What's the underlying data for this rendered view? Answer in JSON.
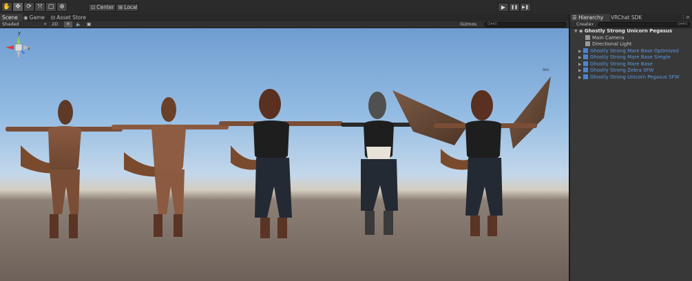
{
  "toolbar": {
    "tools": [
      {
        "name": "hand-tool-icon",
        "glyph": "✋"
      },
      {
        "name": "move-tool-icon",
        "glyph": "✥"
      },
      {
        "name": "rotate-tool-icon",
        "glyph": "⟳"
      },
      {
        "name": "scale-tool-icon",
        "glyph": "⤧"
      },
      {
        "name": "rect-tool-icon",
        "glyph": "▢"
      },
      {
        "name": "transform-tool-icon",
        "glyph": "⊕"
      }
    ],
    "pivot_label": "Center",
    "space_label": "Local",
    "play_icons": {
      "play": "▶",
      "pause": "❚❚",
      "step": "▶❚"
    }
  },
  "scene_tabs": [
    {
      "label": "Scene",
      "icon": "#"
    },
    {
      "label": "Game",
      "icon": "◉"
    },
    {
      "label": "Asset Store",
      "icon": "🛒"
    }
  ],
  "scene_bar": {
    "shading": "Shaded",
    "mode_2d": "2D",
    "light_icon": "☀",
    "audio_icon": "🔈",
    "fx_icon": "▣",
    "gizmos": "Gizmos",
    "search_placeholder": "Q▾All"
  },
  "gizmo": {
    "y_label": "y",
    "x_label": "x",
    "iso_label": "Iso"
  },
  "hierarchy": {
    "tabs": [
      "Hierarchy",
      "VRChat SDK"
    ],
    "create": "Create",
    "search_placeholder": "Q▾All",
    "scene_name": "Ghostly Strong Unicorn Pegasus",
    "children": [
      "Main Camera",
      "Directional Light"
    ],
    "prefabs": [
      "Ghostly Strong Mare Base Optimized",
      "Ghostly Strong Mare Base Simple",
      "Ghostly Strong Mare Base",
      "Ghostly Strong Zebra SFW",
      "Ghostly Strong Unicorn Pegasus SFW"
    ]
  },
  "colors": {
    "prefab_blue": "#5d9ae0",
    "sky_top": "#6f9dd1",
    "ground": "#7a6c63",
    "fur_brown": "#7a4e36",
    "denim": "#242a33"
  }
}
